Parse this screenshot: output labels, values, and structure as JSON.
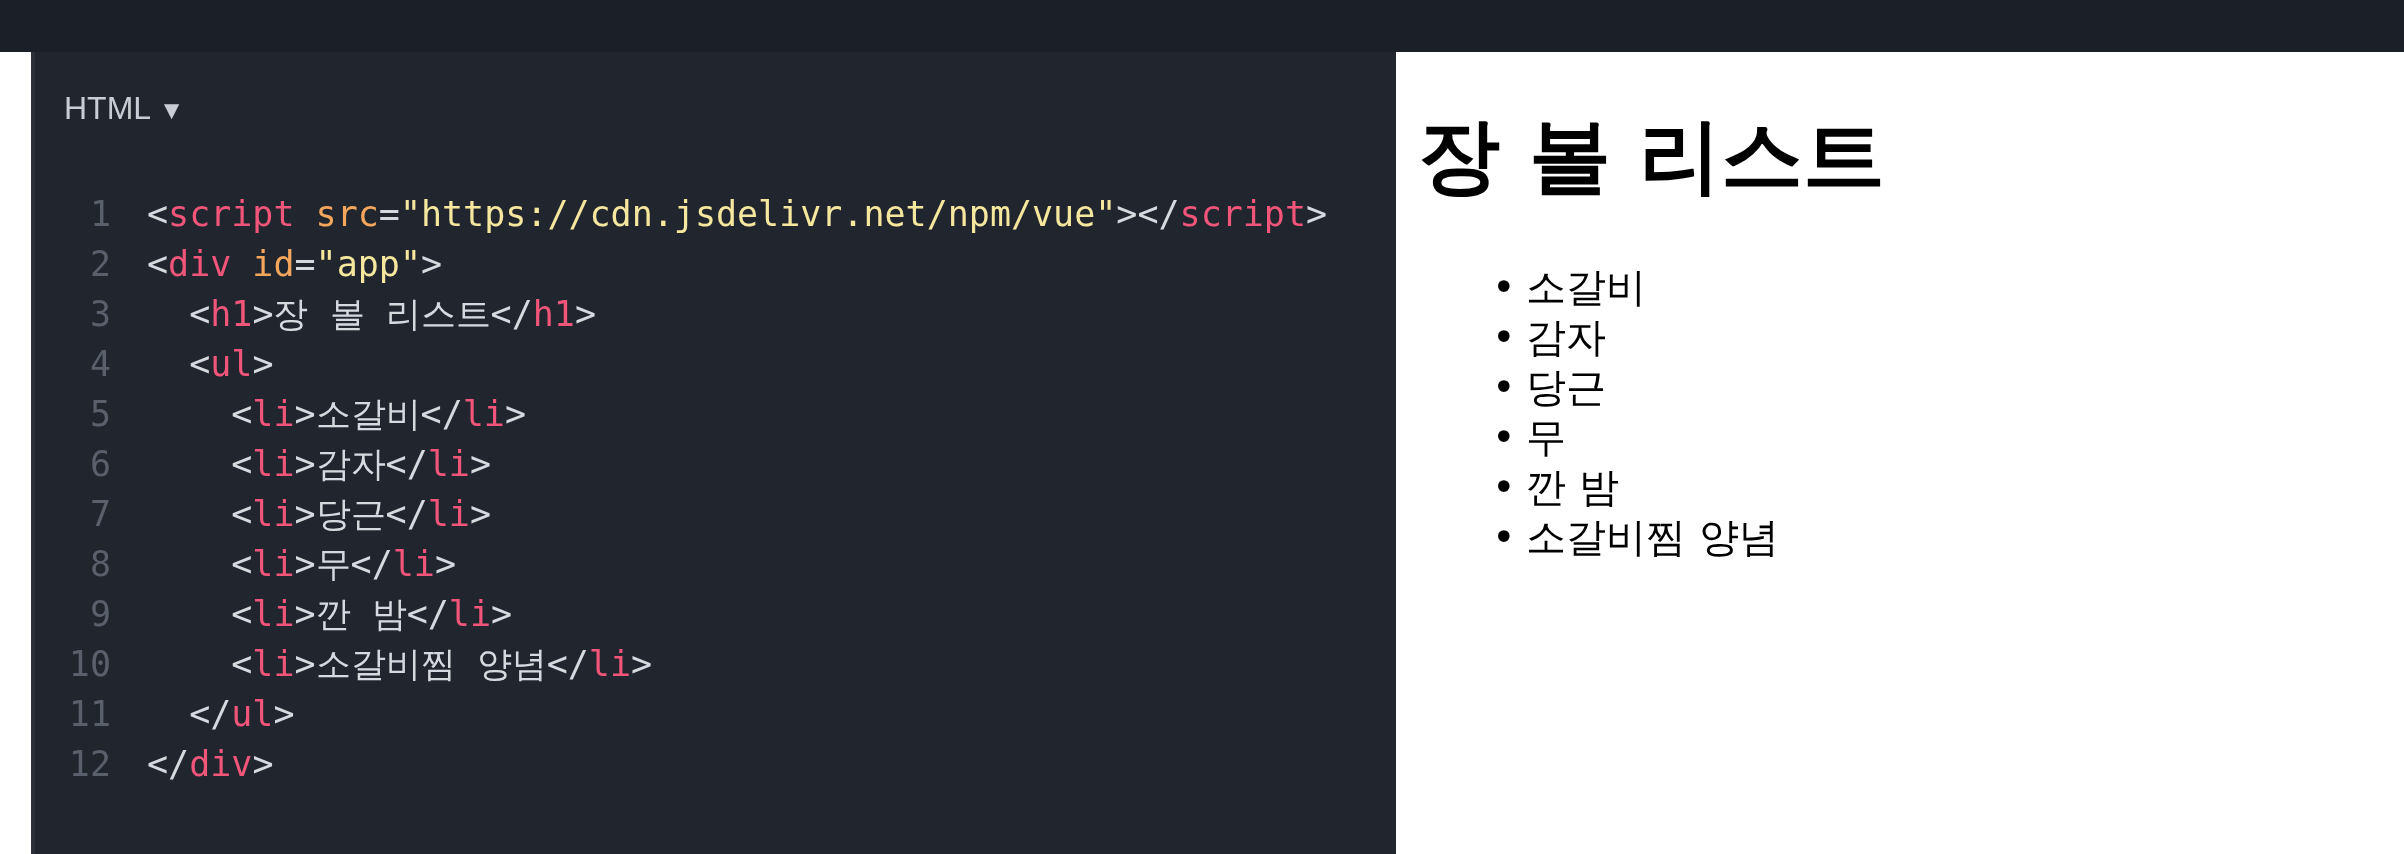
{
  "editor": {
    "language": "HTML",
    "dropdown_glyph": "▼",
    "lines": [
      {
        "number": "1",
        "tokens": [
          {
            "kind": "punct",
            "text": "<"
          },
          {
            "kind": "tag",
            "text": "script"
          },
          {
            "kind": "attr",
            "text": " src"
          },
          {
            "kind": "punct",
            "text": "="
          },
          {
            "kind": "string",
            "text": "\"https://cdn.jsdelivr.net/npm/vue\""
          },
          {
            "kind": "punct",
            "text": "></"
          },
          {
            "kind": "tag",
            "text": "script"
          },
          {
            "kind": "punct",
            "text": ">"
          }
        ]
      },
      {
        "number": "2",
        "tokens": [
          {
            "kind": "punct",
            "text": "<"
          },
          {
            "kind": "tag",
            "text": "div"
          },
          {
            "kind": "attr",
            "text": " id"
          },
          {
            "kind": "punct",
            "text": "="
          },
          {
            "kind": "string",
            "text": "\"app\""
          },
          {
            "kind": "punct",
            "text": ">"
          }
        ]
      },
      {
        "number": "3",
        "tokens": [
          {
            "kind": "punct",
            "text": "  <"
          },
          {
            "kind": "tag",
            "text": "h1"
          },
          {
            "kind": "punct",
            "text": ">장 볼 리스트</"
          },
          {
            "kind": "tag",
            "text": "h1"
          },
          {
            "kind": "punct",
            "text": ">"
          }
        ]
      },
      {
        "number": "4",
        "tokens": [
          {
            "kind": "punct",
            "text": "  <"
          },
          {
            "kind": "tag",
            "text": "ul"
          },
          {
            "kind": "punct",
            "text": ">"
          }
        ]
      },
      {
        "number": "5",
        "tokens": [
          {
            "kind": "punct",
            "text": "    <"
          },
          {
            "kind": "tag",
            "text": "li"
          },
          {
            "kind": "punct",
            "text": ">소갈비</"
          },
          {
            "kind": "tag",
            "text": "li"
          },
          {
            "kind": "punct",
            "text": ">"
          }
        ]
      },
      {
        "number": "6",
        "tokens": [
          {
            "kind": "punct",
            "text": "    <"
          },
          {
            "kind": "tag",
            "text": "li"
          },
          {
            "kind": "punct",
            "text": ">감자</"
          },
          {
            "kind": "tag",
            "text": "li"
          },
          {
            "kind": "punct",
            "text": ">"
          }
        ]
      },
      {
        "number": "7",
        "tokens": [
          {
            "kind": "punct",
            "text": "    <"
          },
          {
            "kind": "tag",
            "text": "li"
          },
          {
            "kind": "punct",
            "text": ">당근</"
          },
          {
            "kind": "tag",
            "text": "li"
          },
          {
            "kind": "punct",
            "text": ">"
          }
        ]
      },
      {
        "number": "8",
        "tokens": [
          {
            "kind": "punct",
            "text": "    <"
          },
          {
            "kind": "tag",
            "text": "li"
          },
          {
            "kind": "punct",
            "text": ">무</"
          },
          {
            "kind": "tag",
            "text": "li"
          },
          {
            "kind": "punct",
            "text": ">"
          }
        ]
      },
      {
        "number": "9",
        "tokens": [
          {
            "kind": "punct",
            "text": "    <"
          },
          {
            "kind": "tag",
            "text": "li"
          },
          {
            "kind": "punct",
            "text": ">깐 밤</"
          },
          {
            "kind": "tag",
            "text": "li"
          },
          {
            "kind": "punct",
            "text": ">"
          }
        ]
      },
      {
        "number": "10",
        "tokens": [
          {
            "kind": "punct",
            "text": "    <"
          },
          {
            "kind": "tag",
            "text": "li"
          },
          {
            "kind": "punct",
            "text": ">소갈비찜 양념</"
          },
          {
            "kind": "tag",
            "text": "li"
          },
          {
            "kind": "punct",
            "text": ">"
          }
        ]
      },
      {
        "number": "11",
        "tokens": [
          {
            "kind": "punct",
            "text": "  </"
          },
          {
            "kind": "tag",
            "text": "ul"
          },
          {
            "kind": "punct",
            "text": ">"
          }
        ]
      },
      {
        "number": "12",
        "tokens": [
          {
            "kind": "punct",
            "text": "</"
          },
          {
            "kind": "tag",
            "text": "div"
          },
          {
            "kind": "punct",
            "text": ">"
          }
        ]
      }
    ]
  },
  "preview": {
    "heading": "장 볼 리스트",
    "items": [
      {
        "bullet": "•",
        "text": "소갈비"
      },
      {
        "bullet": "•",
        "text": "감자"
      },
      {
        "bullet": "•",
        "text": "당근"
      },
      {
        "bullet": "•",
        "text": "무"
      },
      {
        "bullet": "•",
        "text": "깐 밤"
      },
      {
        "bullet": "•",
        "text": "소갈비찜 양념"
      }
    ]
  }
}
